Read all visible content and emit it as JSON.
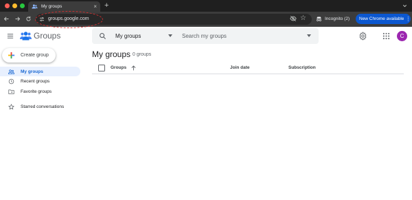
{
  "browser": {
    "tab_title": "My groups",
    "url": "groups.google.com",
    "incognito_label": "Incognito (2)",
    "update_label": "New Chrome available",
    "update_menu_glyph": "⋮",
    "tab_close_glyph": "×",
    "new_tab_glyph": "+",
    "bookmark_glyph": "☆"
  },
  "app": {
    "name": "Groups",
    "avatar_letter": "C",
    "avatar_color": "#9c27b0"
  },
  "search": {
    "scope": "My groups",
    "placeholder": "Search my groups"
  },
  "sidebar": {
    "create_label": "Create group",
    "items": [
      {
        "label": "My groups",
        "icon": "people-icon",
        "active": true
      },
      {
        "label": "Recent groups",
        "icon": "clock-icon",
        "active": false
      },
      {
        "label": "Favorite groups",
        "icon": "folder-star-icon",
        "active": false
      },
      {
        "label": "Starred conversations",
        "icon": "star-icon",
        "active": false
      }
    ]
  },
  "main": {
    "title": "My groups",
    "count": "0 groups",
    "columns": {
      "groups": "Groups",
      "join_date": "Join date",
      "subscription": "Subscription"
    }
  },
  "colors": {
    "accent": "#1967d2",
    "active_bg": "#e8f0fe",
    "chrome_dark": "#1f1f1f",
    "update_blue": "#0b57d0"
  }
}
